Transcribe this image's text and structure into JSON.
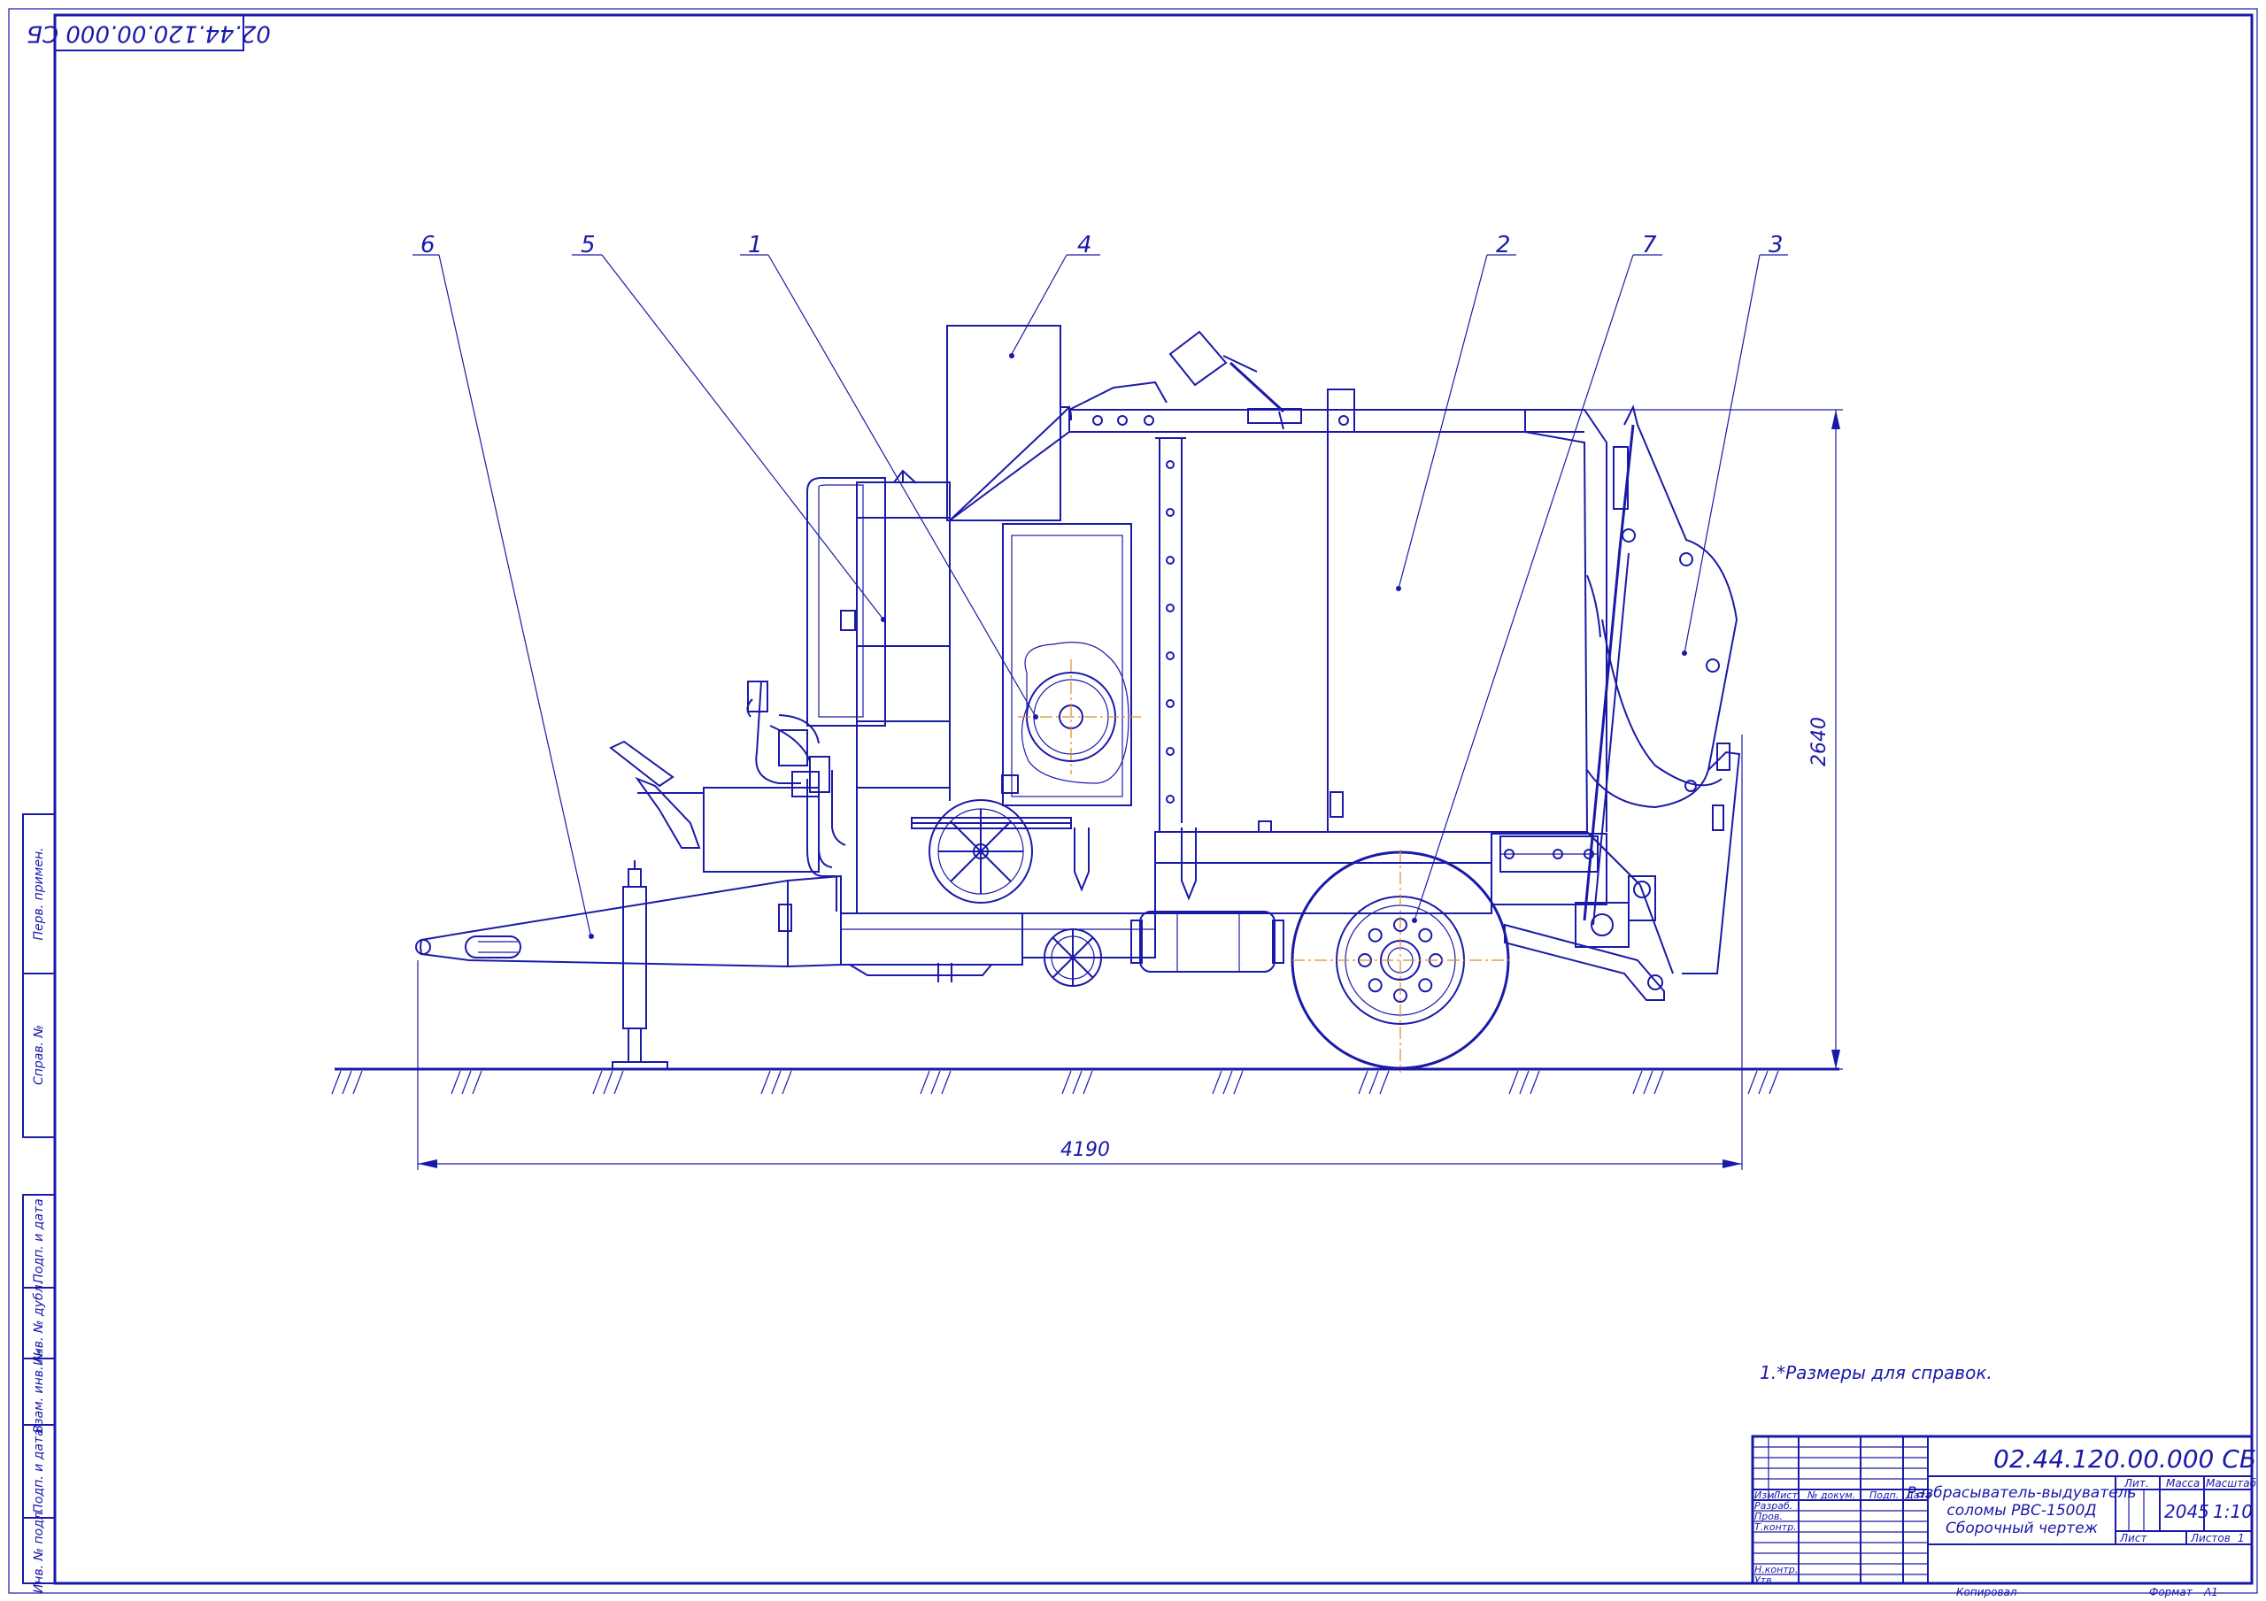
{
  "drawing_number": "02.44.120.00.000 СБ",
  "corner_stamp": "02.44.120.00.000 СБ",
  "title_lines": [
    "Разбрасыватель-выдуватель",
    "соломы РВС-1500Д",
    "Сборочный чертеж"
  ],
  "note": "1.*Размеры для справок.",
  "dimensions": {
    "length": "4190",
    "height": "2640"
  },
  "callouts": [
    "6",
    "5",
    "1",
    "4",
    "2",
    "7",
    "3"
  ],
  "left_margin_labels": [
    "Перв. примен.",
    "Справ. №",
    "Подп. и дата",
    "Инв. № дубл.",
    "Взам. инв. №",
    "Подп. и дата",
    "Инв. № подл."
  ],
  "title_block": {
    "col_headers": [
      "Изм.",
      "Лист",
      "№ докум.",
      "Подп.",
      "Дата"
    ],
    "roles": [
      "Разраб.",
      "Пров.",
      "Т.контр.",
      "Н.контр.",
      "Утв."
    ],
    "lit_header": "Лит.",
    "mass_header": "Масса",
    "scale_header": "Масштаб",
    "mass_value": "2045",
    "scale_value": "1:10",
    "sheet_label": "Лист",
    "sheets_label": "Листов",
    "sheets_value": "1"
  },
  "footer": {
    "copied": "Копировал",
    "format_label": "Формат",
    "format_value": "А1"
  },
  "colors": {
    "line": "#1a1aa8",
    "axis": "#e08a2a",
    "paper": "#ffffff"
  }
}
